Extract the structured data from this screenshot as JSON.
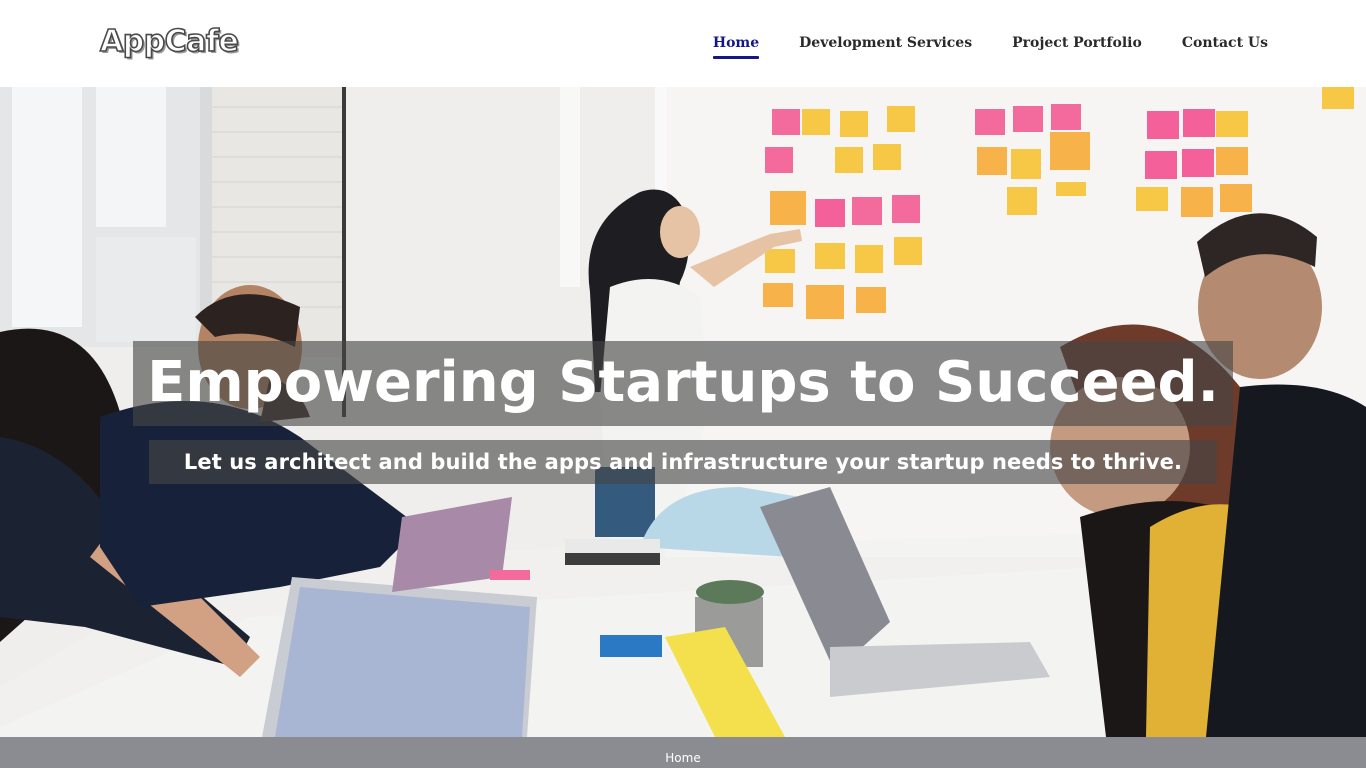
{
  "brand": {
    "logo_text": "AppCafe"
  },
  "nav": {
    "items": [
      {
        "label": "Home",
        "active": true
      },
      {
        "label": "Development Services",
        "active": false
      },
      {
        "label": "Project Portfolio",
        "active": false
      },
      {
        "label": "Contact Us",
        "active": false
      }
    ]
  },
  "hero": {
    "headline": "Empowering Startups to Succeed.",
    "subheadline": "Let us architect and build the apps and infrastructure your startup needs to thrive."
  },
  "footer": {
    "link_label": "Home"
  },
  "colors": {
    "accent": "#15168c",
    "nav_text": "#2a2a2a",
    "overlay": "#464646",
    "footer_bg": "#8b8c91"
  }
}
